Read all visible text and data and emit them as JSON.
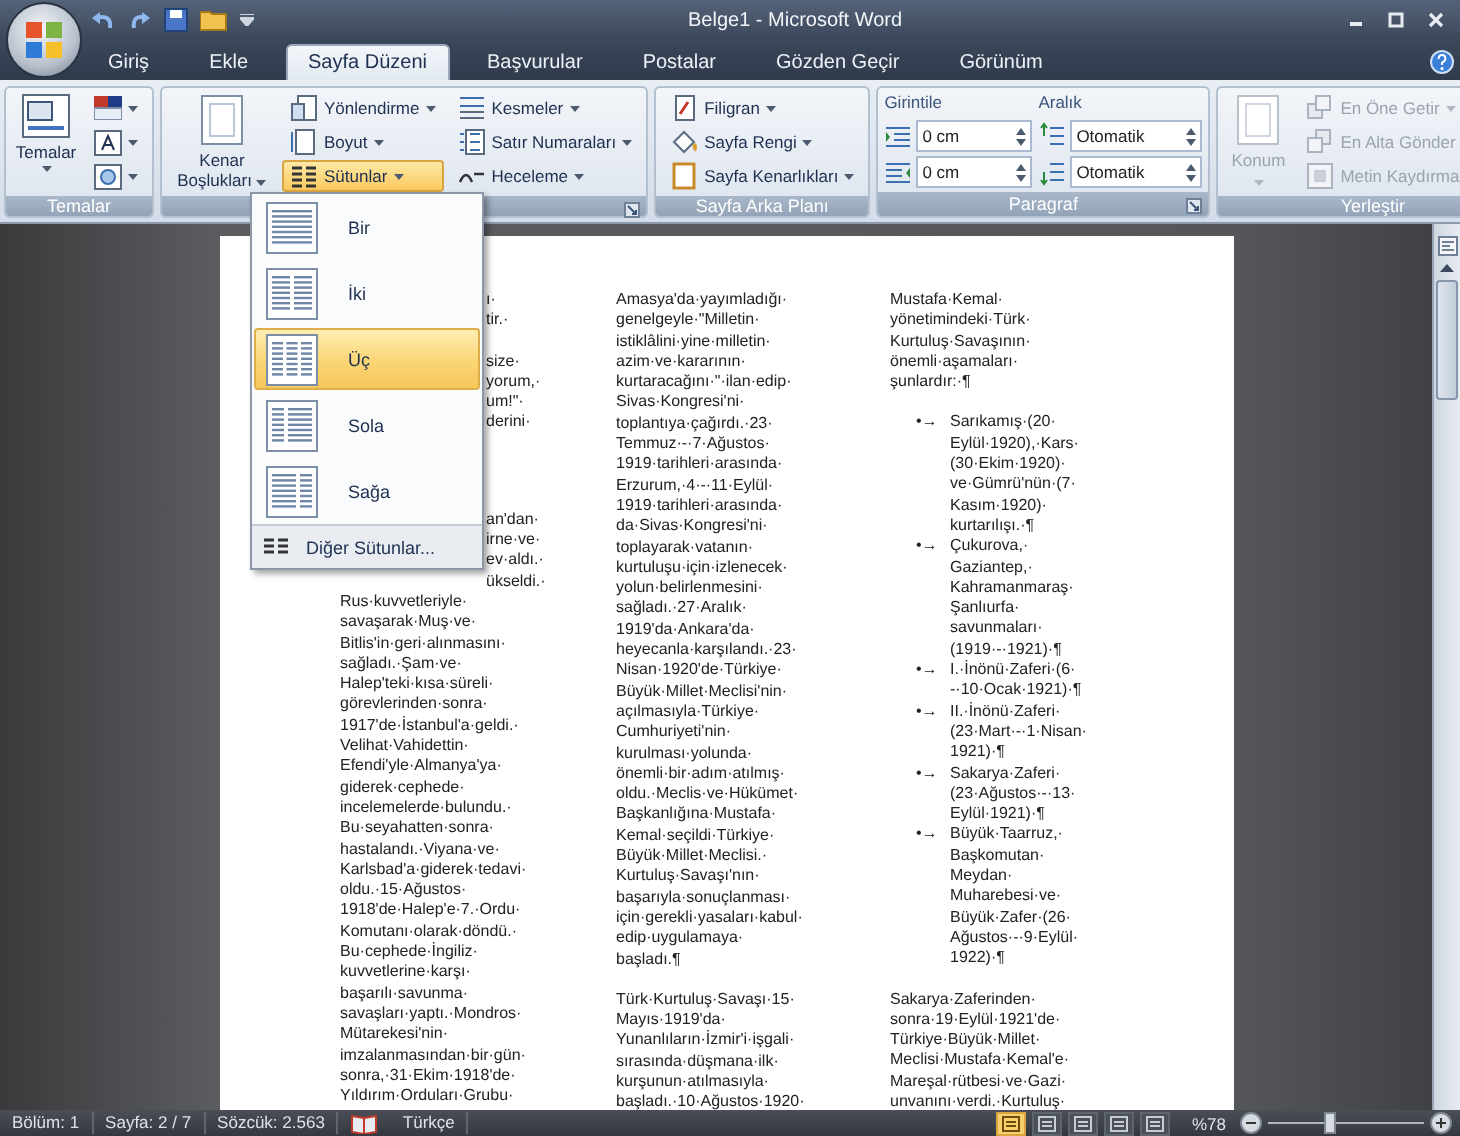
{
  "title_bar": {
    "title": "Belge1 - Microsoft Word"
  },
  "tabs": [
    {
      "label": "Giriş",
      "selected": false
    },
    {
      "label": "Ekle",
      "selected": false
    },
    {
      "label": "Sayfa Düzeni",
      "selected": true
    },
    {
      "label": "Başvurular",
      "selected": false
    },
    {
      "label": "Postalar",
      "selected": false
    },
    {
      "label": "Gözden Geçir",
      "selected": false
    },
    {
      "label": "Görünüm",
      "selected": false
    }
  ],
  "ribbon": {
    "groups": [
      {
        "kind": "themes",
        "label": "Temalar",
        "launcher": false,
        "big_button": {
          "label": "Temalar",
          "disabled": false
        }
      },
      {
        "kind": "buttons",
        "launcher": true,
        "big_button": {
          "label": "Kenar Boşlukları",
          "disabled": false
        },
        "stacks": [
          [
            {
              "kind": "orientation",
              "label": "Yönlendirme",
              "open": false,
              "disabled": false
            },
            {
              "kind": "size",
              "label": "Boyut",
              "open": false,
              "disabled": false
            },
            {
              "kind": "columns",
              "label": "Sütunlar",
              "open": true,
              "disabled": false
            }
          ],
          [
            {
              "kind": "breaks",
              "label": "Kesmeler",
              "open": false,
              "disabled": false
            },
            {
              "kind": "line_numbers",
              "label": "Satır Numaraları",
              "open": false,
              "disabled": false
            },
            {
              "kind": "hyphenation",
              "label": "Heceleme",
              "open": false,
              "disabled": false
            }
          ]
        ]
      },
      {
        "kind": "buttons",
        "label": "Sayfa Arka Planı",
        "launcher": false,
        "stacks": [
          [
            {
              "kind": "watermark",
              "label": "Filigran",
              "open": false,
              "disabled": false
            },
            {
              "kind": "page_color",
              "label": "Sayfa Rengi",
              "open": false,
              "disabled": false
            },
            {
              "kind": "page_borders",
              "label": "Sayfa Kenarlıkları",
              "open": false,
              "disabled": false
            }
          ]
        ]
      },
      {
        "kind": "paragraph",
        "label": "Paragraf",
        "launcher": true,
        "sections": [
          {
            "label": "Girintile",
            "fields": [
              {
                "kind": "indent_left",
                "value": "0 cm"
              },
              {
                "kind": "indent_right",
                "value": "0 cm"
              }
            ]
          },
          {
            "label": "Aralık",
            "fields": [
              {
                "kind": "space_before",
                "value": "Otomatik"
              },
              {
                "kind": "space_after",
                "value": "Otomatik"
              }
            ]
          }
        ]
      },
      {
        "kind": "buttons",
        "label": "Yerleştir",
        "launcher": false,
        "big_button": {
          "label": "Konum",
          "disabled": true
        },
        "stacks": [
          [
            {
              "kind": "bring_front",
              "label": "En Öne Getir",
              "open": false,
              "disabled": true
            },
            {
              "kind": "send_back",
              "label": "En Alta Gönder",
              "open": false,
              "disabled": true
            },
            {
              "kind": "text_wrap",
              "label": "Metin Kaydırma",
              "open": false,
              "disabled": true
            }
          ]
        ]
      }
    ]
  },
  "columns_menu": {
    "items": [
      {
        "kind": "one",
        "label": "Bir",
        "selected": false
      },
      {
        "kind": "two",
        "label": "İki",
        "selected": false
      },
      {
        "kind": "three",
        "label": "Üç",
        "selected": true
      },
      {
        "kind": "left",
        "label": "Sola",
        "selected": false
      },
      {
        "kind": "right",
        "label": "Sağa",
        "selected": false
      }
    ],
    "footer": "Diğer Sütunlar..."
  },
  "document": {
    "columns": [
      {
        "blocks": [
          {
            "kind": "partly_hidden",
            "lines": [
              "ı·",
              "tir.·"
            ]
          },
          {
            "kind": "partly_hidden",
            "lines": [
              "size·",
              "yorum,·",
              "um!\"·",
              "derini·"
            ]
          },
          {
            "kind": "partly_hidden",
            "lines": [
              "an'dan·",
              "irne·ve·",
              "ev·aldı.·",
              "ükseldi.·"
            ]
          },
          {
            "kind": "paragraph",
            "lines": [
              "Rus·kuvvetleriyle·",
              "savaşarak·Muş·ve·",
              "Bitlis'in·geri·alınmasını·",
              "sağladı.·Şam·ve·",
              "Halep'teki·kısa·süreli·",
              "görevlerinden·sonra·",
              "1917'de·İstanbul'a·geldi.·",
              "Velihat·Vahidettin·",
              "Efendi'yle·Almanya'ya·",
              "giderek·cephede·",
              "incelemelerde·bulundu.·",
              "Bu·seyahatten·sonra·",
              "hastalandı.·Viyana·ve·",
              "Karlsbad'a·giderek·tedavi·",
              "oldu.·15·Ağustos·",
              "1918'de·Halep'e·7.·Ordu·",
              "Komutanı·olarak·döndü.·",
              "Bu·cephede·İngiliz·",
              "kuvvetlerine·karşı·",
              "başarılı·savunma·",
              "savaşları·yaptı.·Mondros·",
              "Mütarekesi'nin·",
              "imzalanmasından·bir·gün·",
              "sonra,·31·Ekim·1918'de·",
              "Yıldırım·Orduları·Grubu·"
            ]
          }
        ]
      },
      {
        "blocks": [
          {
            "kind": "paragraph",
            "lines": [
              "Amasya'da·yayımladığı·",
              "genelgeyle·\"Milletin·",
              "istiklâlini·yine·milletin·",
              "azim·ve·kararının·",
              "kurtaracağını·\"·ilan·edip·",
              "Sivas·Kongresi'ni·",
              "toplantıya·çağırdı.·23·",
              "Temmuz·-·7·Ağustos·",
              "1919·tarihleri·arasında·",
              "Erzurum,·4·-·11·Eylül·",
              "1919·tarihleri·arasında·",
              "da·Sivas·Kongresi'ni·",
              "toplayarak·vatanın·",
              "kurtuluşu·için·izlenecek·",
              "yolun·belirlenmesini·",
              "sağladı.·27·Aralık·",
              "1919'da·Ankara'da·",
              "heyecanla·karşılandı.·23·",
              "Nisan·1920'de·Türkiye·",
              "Büyük·Millet·Meclisi'nin·",
              "açılmasıyla·Türkiye·",
              "Cumhuriyeti'nin·",
              "kurulması·yolunda·",
              "önemli·bir·adım·atılmış·",
              "oldu.·Meclis·ve·Hükümet·",
              "Başkanlığına·Mustafa·",
              "Kemal·seçildi·Türkiye·",
              "Büyük·Millet·Meclisi.·",
              "Kurtuluş·Savaşı'nın·",
              "başarıyla·sonuçlanması·",
              "için·gerekli·yasaları·kabul·",
              "edip·uygulamaya·",
              "başladı.¶"
            ]
          },
          {
            "kind": "paragraph",
            "lines": [
              "Türk·Kurtuluş·Savaşı·15·",
              "Mayıs·1919'da·",
              "Yunanlıların·İzmir'i·işgali·",
              "sırasında·düşmana·ilk·",
              "kurşunun·atılmasıyla·",
              "başladı.·10·Ağustos·1920·"
            ]
          }
        ]
      },
      {
        "blocks": [
          {
            "kind": "paragraph",
            "lines": [
              "Mustafa·Kemal·",
              "yönetimindeki·Türk·",
              "Kurtuluş·Savaşının·",
              "önemli·aşamaları·",
              "şunlardır:·¶"
            ]
          },
          {
            "kind": "bullet",
            "marker": "•→",
            "lines": [
              "Sarıkamış·(20·",
              "Eylül·1920),·Kars·",
              "(30·Ekim·1920)·",
              "ve·Gümrü'nün·(7·",
              "Kasım·1920)·",
              "kurtarılışı.·¶"
            ]
          },
          {
            "kind": "bullet",
            "marker": "•→",
            "lines": [
              "Çukurova,·",
              "Gaziantep,·",
              "Kahramanmaraş·",
              "Şanlıurfa·",
              "savunmaları·",
              "(1919·-·1921)·¶"
            ]
          },
          {
            "kind": "bullet",
            "marker": "•→",
            "lines": [
              "I.·İnönü·Zaferi·(6·",
              "-·10·Ocak·1921)·¶"
            ]
          },
          {
            "kind": "bullet",
            "marker": "•→",
            "lines": [
              "II.·İnönü·Zaferi·",
              "(23·Mart·-·1·Nisan·",
              "1921)·¶"
            ]
          },
          {
            "kind": "bullet",
            "marker": "•→",
            "lines": [
              "Sakarya·Zaferi·",
              "(23·Ağustos·-·13·",
              "Eylül·1921)·¶"
            ]
          },
          {
            "kind": "bullet",
            "marker": "•→",
            "lines": [
              "Büyük·Taarruz,·",
              "Başkomutan·",
              "Meydan·",
              "Muharebesi·ve·",
              "Büyük·Zafer·(26·",
              "Ağustos·-·9·Eylül·",
              "1922)·¶"
            ]
          },
          {
            "kind": "paragraph",
            "lines": [
              "Sakarya·Zaferinden·",
              "sonra·19·Eylül·1921'de·",
              "Türkiye·Büyük·Millet·",
              "Meclisi·Mustafa·Kemal'e·",
              "Mareşal·rütbesi·ve·Gazi·",
              "unvanını·verdi.·Kurtuluş·"
            ]
          }
        ]
      }
    ]
  },
  "status_bar": {
    "items": [
      "Bölüm: 1",
      "Sayfa: 2 / 7",
      "Sözcük: 2.563"
    ],
    "language": "Türkçe",
    "views": [
      {
        "selected": true
      },
      {
        "selected": false
      },
      {
        "selected": false
      },
      {
        "selected": false
      },
      {
        "selected": false
      }
    ],
    "zoom": {
      "label": "%78",
      "level": 0.4
    }
  }
}
